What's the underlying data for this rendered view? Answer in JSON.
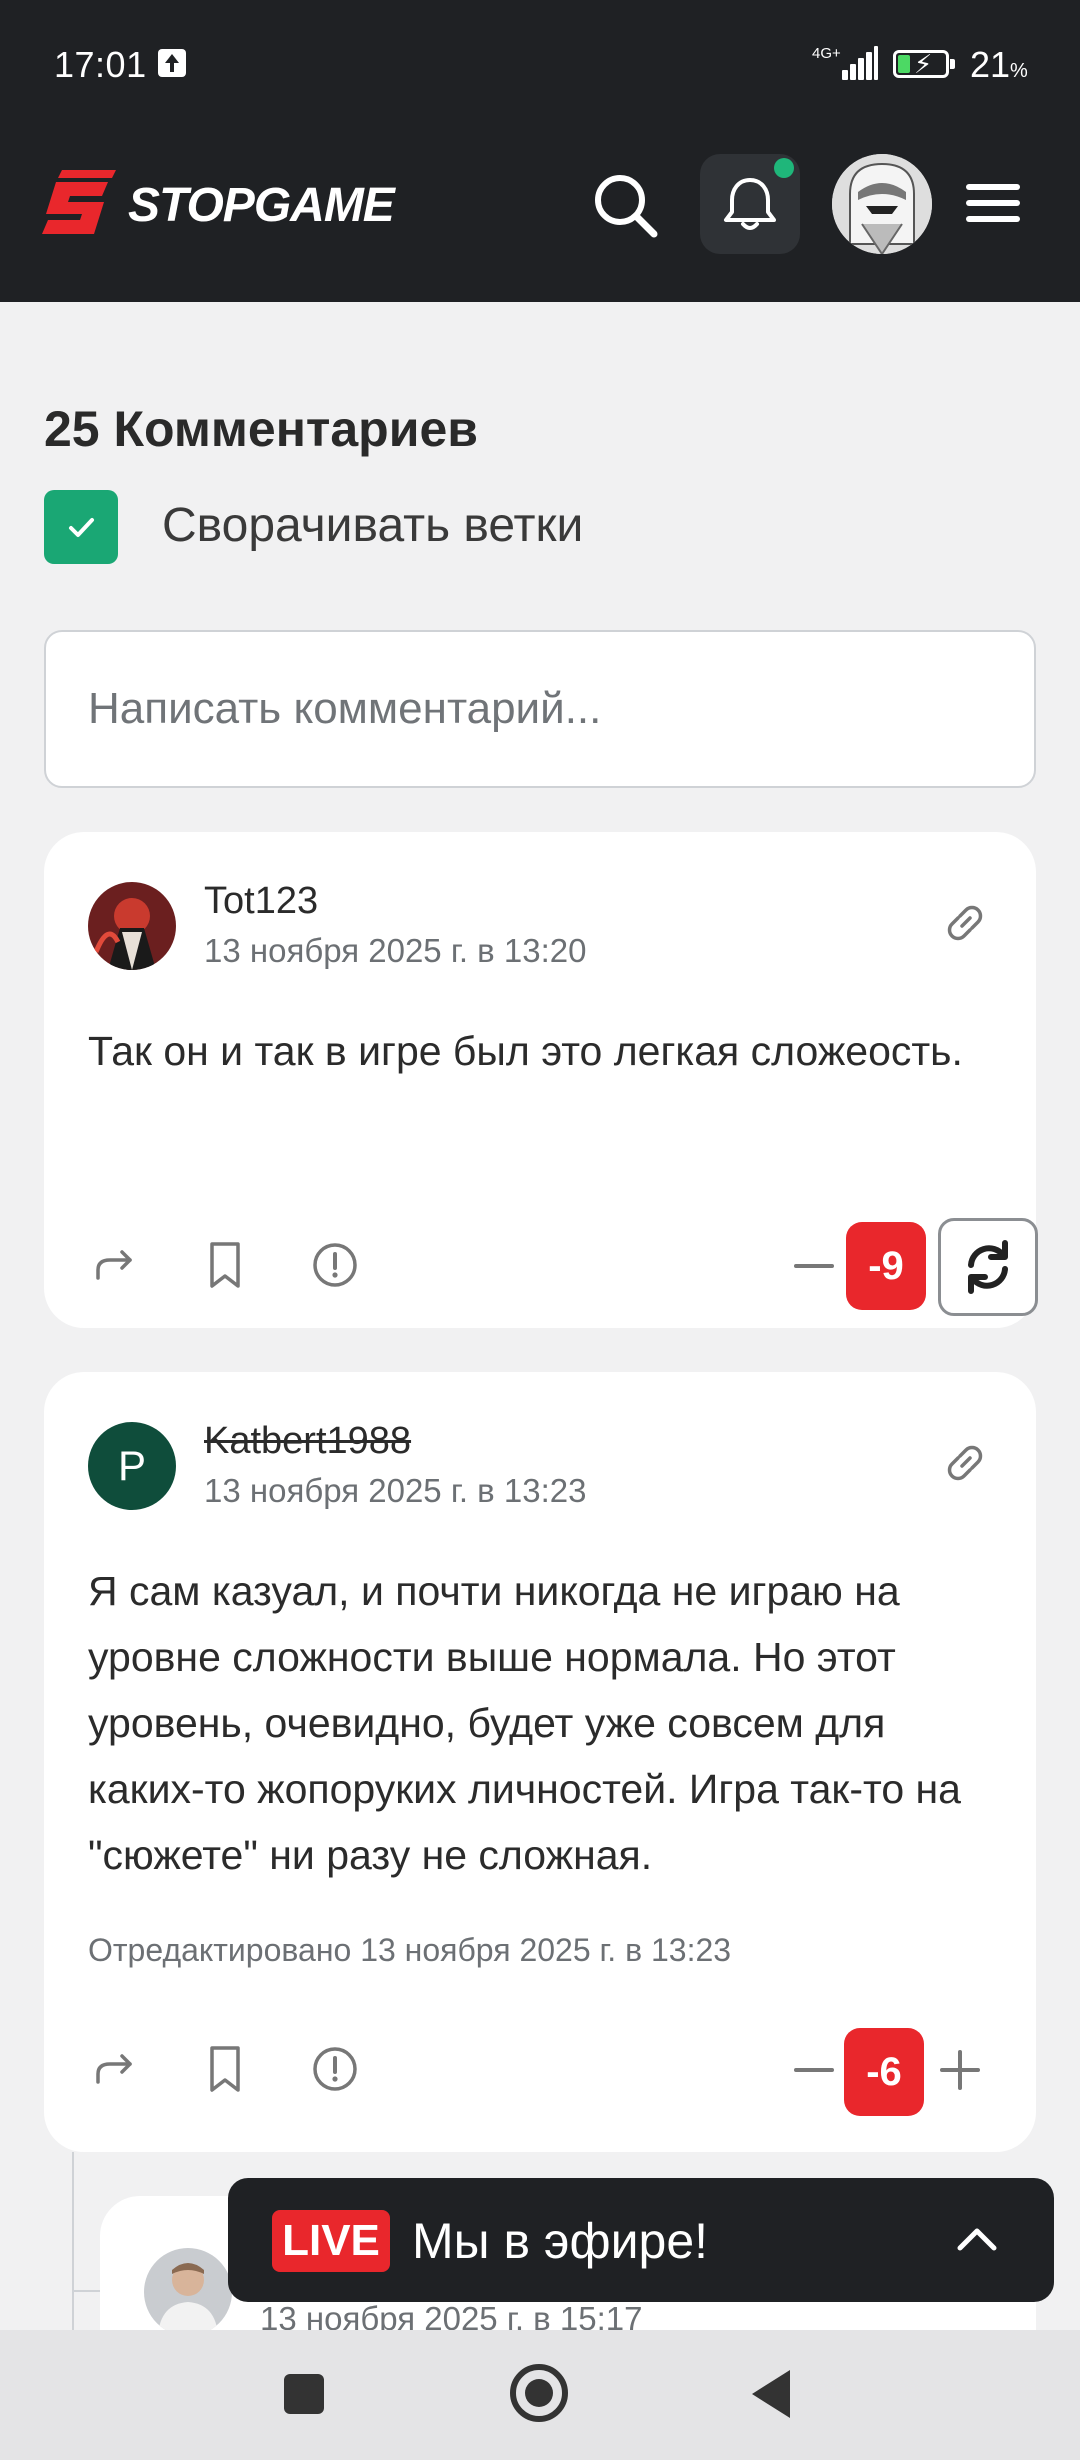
{
  "status_bar": {
    "time": "17:01",
    "network": "4G+",
    "battery_percent": "21",
    "battery_unit": "%"
  },
  "header": {
    "logo_text": "STOPGAME",
    "notification_badge": true
  },
  "comments_section": {
    "title": "25 Комментариев",
    "collapse_label": "Сворачивать ветки",
    "collapse_checked": true,
    "input_placeholder": "Написать комментарий..."
  },
  "comments": [
    {
      "author": "Tot123",
      "date": "13 ноября 2025 г. в 13:20",
      "body": "Так он и так в игре был это легкая сложеость.",
      "score": "-9"
    },
    {
      "author": "Katbert1988",
      "avatar_letter": "P",
      "date": "13 ноября 2025 г. в 13:23",
      "body": "Я сам казуал, и почти никогда не играю на уровне сложности выше нормала. Но этот уровень, очевидно, будет уже совсем для каких-то жопоруких личностей. Игра так-то на \"сюжете\" ни разу не сложная.",
      "edited": "Отредактировано 13 ноября 2025 г. в 13:23",
      "score": "-6"
    },
    {
      "date": "13 ноября 2025 г. в 15:17"
    }
  ],
  "live_banner": {
    "badge": "LIVE",
    "text": "Мы в эфире!"
  },
  "colors": {
    "brand_red": "#e9272c",
    "accent_green": "#1aa774",
    "header_bg": "#1f2124"
  }
}
